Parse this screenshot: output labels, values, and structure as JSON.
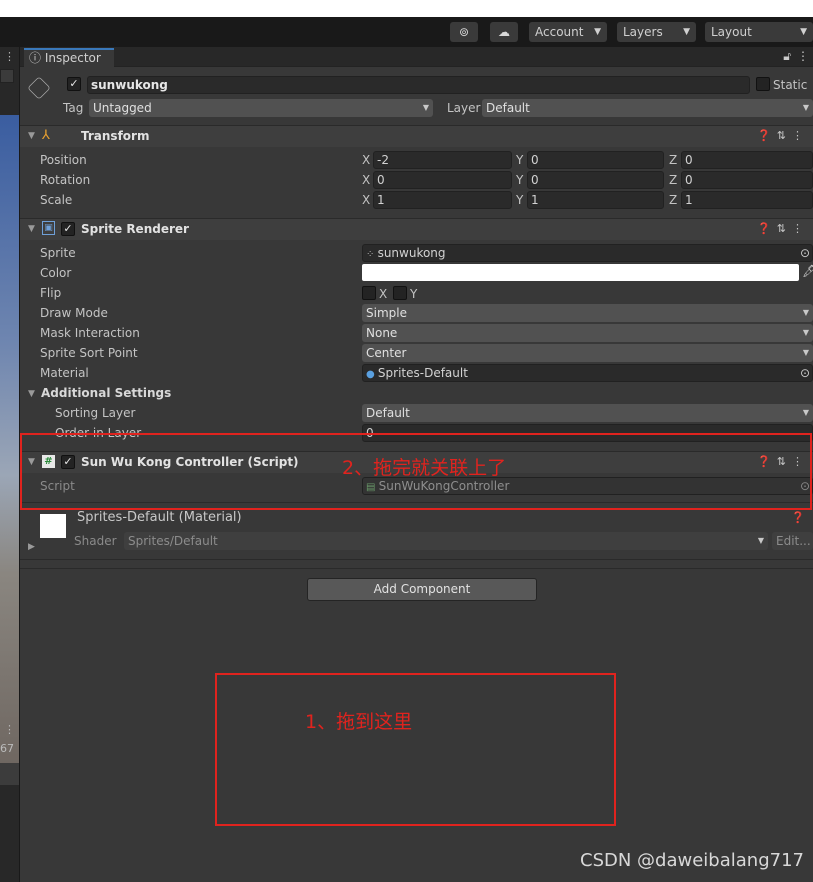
{
  "toolbar": {
    "account_label": "Account",
    "layers_label": "Layers",
    "layout_label": "Layout"
  },
  "left_panel": {
    "clipped_text": "67"
  },
  "inspector": {
    "tab_label": "Inspector",
    "object": {
      "name": "sunwukong",
      "static_label": "Static",
      "tag_label": "Tag",
      "tag_value": "Untagged",
      "layer_label": "Layer",
      "layer_value": "Default"
    },
    "transform": {
      "title": "Transform",
      "rows": [
        {
          "label": "Position",
          "x": "-2",
          "y": "0",
          "z": "0"
        },
        {
          "label": "Rotation",
          "x": "0",
          "y": "0",
          "z": "0"
        },
        {
          "label": "Scale",
          "x": "1",
          "y": "1",
          "z": "1"
        }
      ]
    },
    "sprite_renderer": {
      "title": "Sprite Renderer",
      "sprite_label": "Sprite",
      "sprite_value": "sunwukong",
      "color_label": "Color",
      "flip_label": "Flip",
      "flip_x": "X",
      "flip_y": "Y",
      "draw_mode_label": "Draw Mode",
      "draw_mode_value": "Simple",
      "mask_label": "Mask Interaction",
      "mask_value": "None",
      "sort_point_label": "Sprite Sort Point",
      "sort_point_value": "Center",
      "material_label": "Material",
      "material_value": "Sprites-Default",
      "additional_label": "Additional Settings",
      "sorting_layer_label": "Sorting Layer",
      "sorting_layer_value": "Default",
      "order_label": "Order in Layer",
      "order_value": "0"
    },
    "controller": {
      "title": "Sun Wu Kong Controller (Script)",
      "script_label": "Script",
      "script_value": "SunWuKongController"
    },
    "material": {
      "title": "Sprites-Default (Material)",
      "shader_label": "Shader",
      "shader_value": "Sprites/Default",
      "edit_label": "Edit..."
    },
    "add_component_label": "Add Component"
  },
  "annotations": {
    "note_1": "1、拖到这里",
    "note_2": "2、拖完就关联上了",
    "color": "#e0231e"
  },
  "watermark": "CSDN @daweibalang717"
}
